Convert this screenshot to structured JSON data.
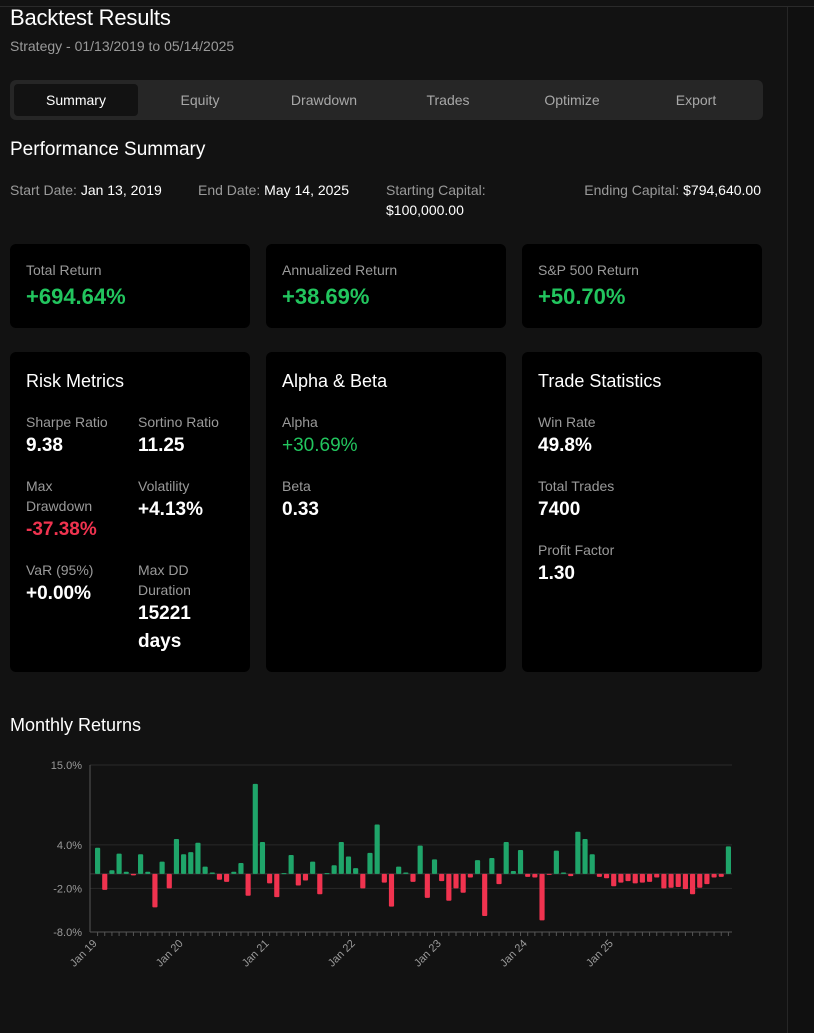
{
  "header": {
    "title": "Backtest Results",
    "subtitle": "Strategy - 01/13/2019 to 05/14/2025"
  },
  "tabs": [
    {
      "label": "Summary",
      "active": true
    },
    {
      "label": "Equity",
      "active": false
    },
    {
      "label": "Drawdown",
      "active": false
    },
    {
      "label": "Trades",
      "active": false
    },
    {
      "label": "Optimize",
      "active": false
    },
    {
      "label": "Export",
      "active": false
    }
  ],
  "performance": {
    "title": "Performance Summary",
    "start_label": "Start Date:",
    "start_value": "Jan 13, 2019",
    "end_label": "End Date:",
    "end_value": "May 14, 2025",
    "starting_capital_label": "Starting Capital:",
    "starting_capital_value": "$100,000.00",
    "ending_capital_label": "Ending Capital:",
    "ending_capital_value": "$794,640.00"
  },
  "returns": {
    "total_label": "Total Return",
    "total_value": "+694.64%",
    "annualized_label": "Annualized Return",
    "annualized_value": "+38.69%",
    "sp500_label": "S&P 500 Return",
    "sp500_value": "+50.70%"
  },
  "risk": {
    "title": "Risk Metrics",
    "sharpe_label": "Sharpe Ratio",
    "sharpe_value": "9.38",
    "sortino_label": "Sortino Ratio",
    "sortino_value": "11.25",
    "maxdd_label_1": "Max",
    "maxdd_label_2": "Drawdown",
    "maxdd_value": "-37.38%",
    "vol_label": "Volatility",
    "vol_value": "+4.13%",
    "var_label": "VaR (95%)",
    "var_value": "+0.00%",
    "ddur_label_1": "Max DD",
    "ddur_label_2": "Duration",
    "ddur_value_1": "15221",
    "ddur_value_2": "days"
  },
  "alpha_beta": {
    "title": "Alpha & Beta",
    "alpha_label": "Alpha",
    "alpha_value": "+30.69%",
    "beta_label": "Beta",
    "beta_value": "0.33"
  },
  "trade_stats": {
    "title": "Trade Statistics",
    "winrate_label": "Win Rate",
    "winrate_value": "49.8%",
    "trades_label": "Total Trades",
    "trades_value": "7400",
    "pf_label": "Profit Factor",
    "pf_value": "1.30"
  },
  "monthly": {
    "title": "Monthly Returns"
  },
  "colors": {
    "positive": "#22c55e",
    "negative": "#f0334f",
    "bar_positive": "#1fa56a",
    "bar_negative": "#f0334f",
    "background": "#121212",
    "card": "#000000"
  },
  "chart_data": {
    "type": "bar",
    "title": "Monthly Returns",
    "y_unit": "%",
    "ylim": [
      -8.0,
      15.0
    ],
    "y_ticks": [
      15.0,
      4.0,
      -2.0,
      -8.0
    ],
    "y_tick_labels": [
      "15.0%",
      "4.0%",
      "-2.0%",
      "-8.0%"
    ],
    "x_tick_labels": [
      "Jan 19",
      "Jan 20",
      "Jan 21",
      "Jan 22",
      "Jan 23",
      "Jan 24",
      "Jan 25"
    ],
    "x_tick_index": [
      0,
      12,
      24,
      36,
      48,
      60,
      72
    ],
    "grid": true,
    "categories": [
      "2019-01",
      "2019-02",
      "2019-03",
      "2019-04",
      "2019-05",
      "2019-06",
      "2019-07",
      "2019-08",
      "2019-09",
      "2019-10",
      "2019-11",
      "2019-12",
      "2020-01",
      "2020-02",
      "2020-03",
      "2020-04",
      "2020-05",
      "2020-06",
      "2020-07",
      "2020-08",
      "2020-09",
      "2020-10",
      "2020-11",
      "2020-12",
      "2021-01",
      "2021-02",
      "2021-03",
      "2021-04",
      "2021-05",
      "2021-06",
      "2021-07",
      "2021-08",
      "2021-09",
      "2021-10",
      "2021-11",
      "2021-12",
      "2022-01",
      "2022-02",
      "2022-03",
      "2022-04",
      "2022-05",
      "2022-06",
      "2022-07",
      "2022-08",
      "2022-09",
      "2022-10",
      "2022-11",
      "2022-12",
      "2023-01",
      "2023-02",
      "2023-03",
      "2023-04",
      "2023-05",
      "2023-06",
      "2023-07",
      "2023-08",
      "2023-09",
      "2023-10",
      "2023-11",
      "2023-12",
      "2024-01",
      "2024-02",
      "2024-03",
      "2024-04",
      "2024-05",
      "2024-06",
      "2024-07",
      "2024-08",
      "2024-09",
      "2024-10",
      "2024-11",
      "2024-12",
      "2025-01",
      "2025-02",
      "2025-03",
      "2025-04",
      "2025-05"
    ],
    "values": [
      3.6,
      -2.2,
      0.5,
      2.8,
      0.3,
      -0.2,
      2.7,
      0.3,
      -4.6,
      1.7,
      -2.0,
      4.8,
      2.7,
      3.0,
      4.3,
      1.0,
      0.2,
      -0.8,
      -1.1,
      0.3,
      1.5,
      -3.0,
      12.4,
      4.4,
      -1.3,
      -3.2,
      0.1,
      2.6,
      -1.6,
      -0.9,
      1.7,
      -2.8,
      0.1,
      1.2,
      4.4,
      2.4,
      0.8,
      -2.0,
      2.9,
      6.8,
      -1.2,
      -4.5,
      1.0,
      0.2,
      -1.1,
      3.9,
      -3.3,
      2.0,
      -1.0,
      -3.7,
      -2.0,
      -2.6,
      -0.5,
      1.9,
      -5.8,
      2.2,
      -1.4,
      4.4,
      0.4,
      3.3,
      -0.4,
      -0.5,
      -6.4,
      -0.1,
      3.2,
      0.2,
      -0.3,
      5.8,
      4.8,
      2.7,
      -0.4,
      -0.6,
      -1.7,
      -1.2,
      -1.0,
      -1.3,
      -1.2,
      -1.1,
      -0.5,
      -2.0,
      -1.9,
      -1.8,
      -2.1,
      -2.8,
      -1.9,
      -1.4,
      -0.5,
      -0.4,
      3.8
    ]
  }
}
